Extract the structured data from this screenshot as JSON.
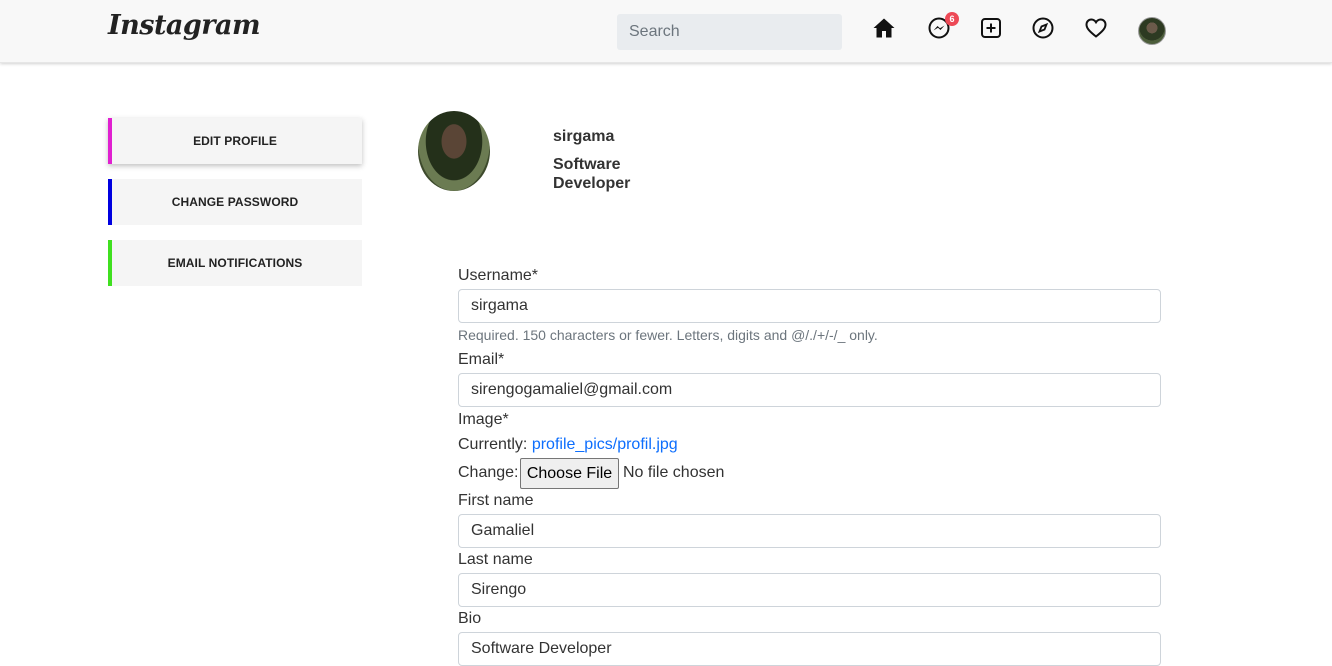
{
  "navbar": {
    "logo": "Instagram",
    "search_placeholder": "Search",
    "messages_badge": "6"
  },
  "sidebar": {
    "items": [
      {
        "label": "EDIT PROFILE",
        "color": "#e020d0"
      },
      {
        "label": "CHANGE PASSWORD",
        "color": "#0000e0"
      },
      {
        "label": "EMAIL NOTIFICATIONS",
        "color": "#40e020"
      }
    ]
  },
  "profile": {
    "username": "sirgama",
    "bio": "Software Developer"
  },
  "form": {
    "username_label": "Username*",
    "username_value": "sirgama",
    "username_help": "Required. 150 characters or fewer. Letters, digits and @/./+/-/_ only.",
    "email_label": "Email*",
    "email_value": "sirengogamaliel@gmail.com",
    "image_label": "Image*",
    "currently_label": "Currently:",
    "currently_link": "profile_pics/profil.jpg",
    "change_label": "Change:",
    "choose_file": "Choose File",
    "no_file": "No file chosen",
    "first_name_label": "First name",
    "first_name_value": "Gamaliel",
    "last_name_label": "Last name",
    "last_name_value": "Sirengo",
    "bio_label": "Bio",
    "bio_value": "Software Developer"
  }
}
